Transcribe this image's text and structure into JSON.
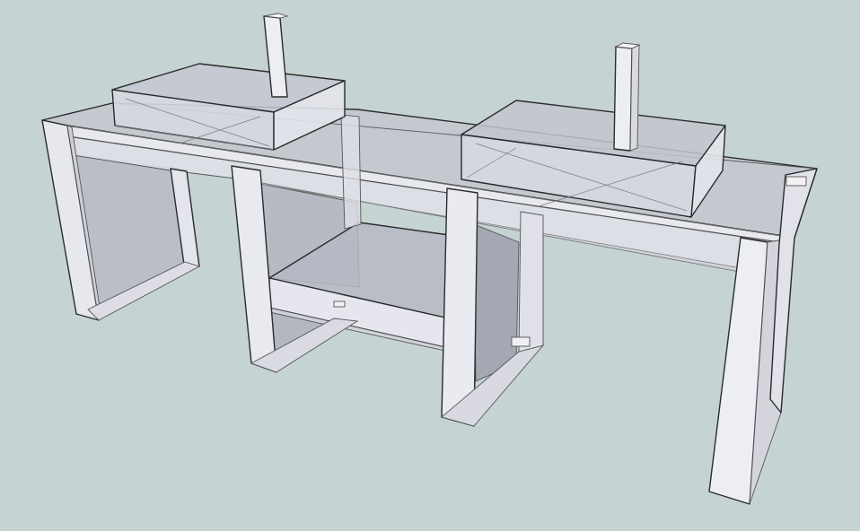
{
  "viewport": {
    "background": "#c5d3d3"
  },
  "model": {
    "face_light": "#eef0f4",
    "face_mid": "#dcdde6",
    "face_glass": "#b9bcc6",
    "face_shadow": "#a7aab5",
    "edge": "#2b2b2b"
  }
}
